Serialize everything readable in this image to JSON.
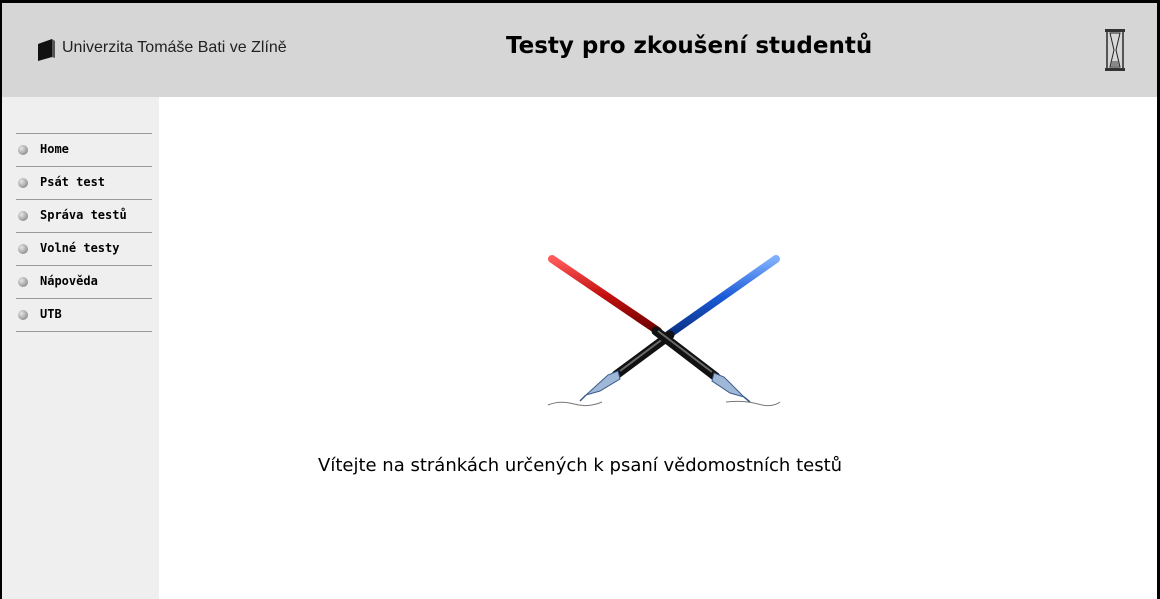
{
  "header": {
    "university_name": "Univerzita Tomáše Bati ve Zlíně",
    "site_title": "Testy pro zkoušení studentů"
  },
  "sidebar": {
    "items": [
      {
        "label": "Home",
        "icon": "bullet-icon"
      },
      {
        "label": "Psát test",
        "icon": "bullet-icon"
      },
      {
        "label": "Správa testů",
        "icon": "bullet-icon"
      },
      {
        "label": "Volné testy",
        "icon": "bullet-icon"
      },
      {
        "label": "Nápověda",
        "icon": "bullet-icon"
      },
      {
        "label": "UTB",
        "icon": "bullet-icon"
      }
    ]
  },
  "main": {
    "illustration": "crossed-fountain-pens",
    "welcome_text": "Vítejte na stránkách určených k psaní vědomostních testů"
  },
  "colors": {
    "header_bg": "#d6d6d6",
    "sidebar_bg": "#efefef",
    "red_pen": "#c41010",
    "blue_pen": "#1a5ad6"
  }
}
